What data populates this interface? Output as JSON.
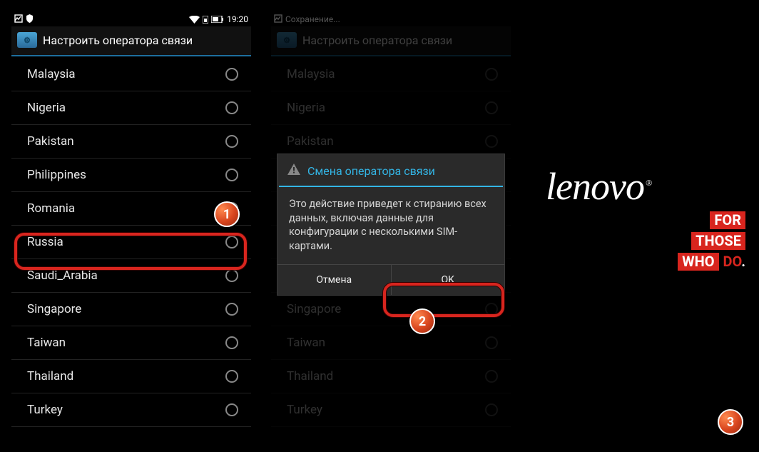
{
  "statusbar": {
    "time": "19:20",
    "saving_text": "Сохранение..."
  },
  "header": {
    "title": "Настроить оператора связи"
  },
  "countries": [
    {
      "label": "Malaysia"
    },
    {
      "label": "Nigeria"
    },
    {
      "label": "Pakistan"
    },
    {
      "label": "Philippines"
    },
    {
      "label": "Romania"
    },
    {
      "label": "Russia"
    },
    {
      "label": "Saudi_Arabia"
    },
    {
      "label": "Singapore"
    },
    {
      "label": "Taiwan"
    },
    {
      "label": "Thailand"
    },
    {
      "label": "Turkey"
    }
  ],
  "dialog": {
    "title": "Смена оператора связи",
    "body": "Это действие приведет к стиранию всех данных, включая данные для конфигурации с несколькими SIM-картами.",
    "cancel": "Отмена",
    "ok": "OK"
  },
  "callouts": {
    "b1": "1",
    "b2": "2",
    "b3": "3"
  },
  "logo": {
    "brand": "lenovo",
    "reg": "®",
    "line1_a": "FOR",
    "line2_a": "THOSE",
    "line3_a": "WHO",
    "line3_b": "DO"
  }
}
